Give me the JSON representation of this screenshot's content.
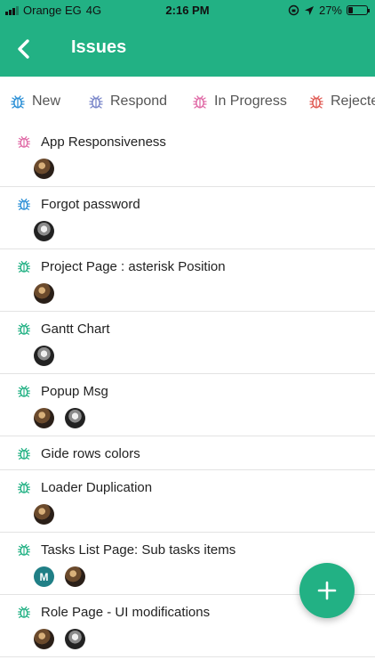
{
  "status": {
    "carrier": "Orange EG",
    "network": "4G",
    "time": "2:16 PM",
    "battery": "27%",
    "battery_level": 0.27
  },
  "header": {
    "title": "Issues",
    "back_icon": "chevron-left-icon"
  },
  "tabs": [
    {
      "label": "New",
      "color": "#2a8fd6"
    },
    {
      "label": "Respond",
      "color": "#7a86c9"
    },
    {
      "label": "In Progress",
      "color": "#e06aa6"
    },
    {
      "label": "Rejecte",
      "color": "#e05b54"
    }
  ],
  "issues": [
    {
      "title": "App Responsiveness",
      "color": "#e06aa6",
      "avatars": [
        "photo-a"
      ]
    },
    {
      "title": "Forgot password",
      "color": "#2a8fd6",
      "avatars": [
        "photo-b"
      ]
    },
    {
      "title": "Project Page : asterisk Position",
      "color": "#22b184",
      "avatars": [
        "photo-a"
      ]
    },
    {
      "title": "Gantt Chart",
      "color": "#22b184",
      "avatars": [
        "photo-b"
      ]
    },
    {
      "title": "Popup Msg",
      "color": "#22b184",
      "avatars": [
        "photo-a",
        "photo-b"
      ]
    },
    {
      "title": "Gide rows colors",
      "color": "#22b184",
      "avatars": []
    },
    {
      "title": "Loader Duplication",
      "color": "#22b184",
      "avatars": [
        "photo-a"
      ]
    },
    {
      "title": "Tasks List Page: Sub tasks items",
      "color": "#22b184",
      "avatars": [
        "initial-M",
        "photo-a"
      ]
    },
    {
      "title": "Role Page - UI modifications",
      "color": "#22b184",
      "avatars": [
        "photo-a",
        "photo-b"
      ]
    }
  ],
  "avatar_initial": "M",
  "fab": {
    "icon": "plus-icon"
  },
  "accent_color": "#22b184"
}
